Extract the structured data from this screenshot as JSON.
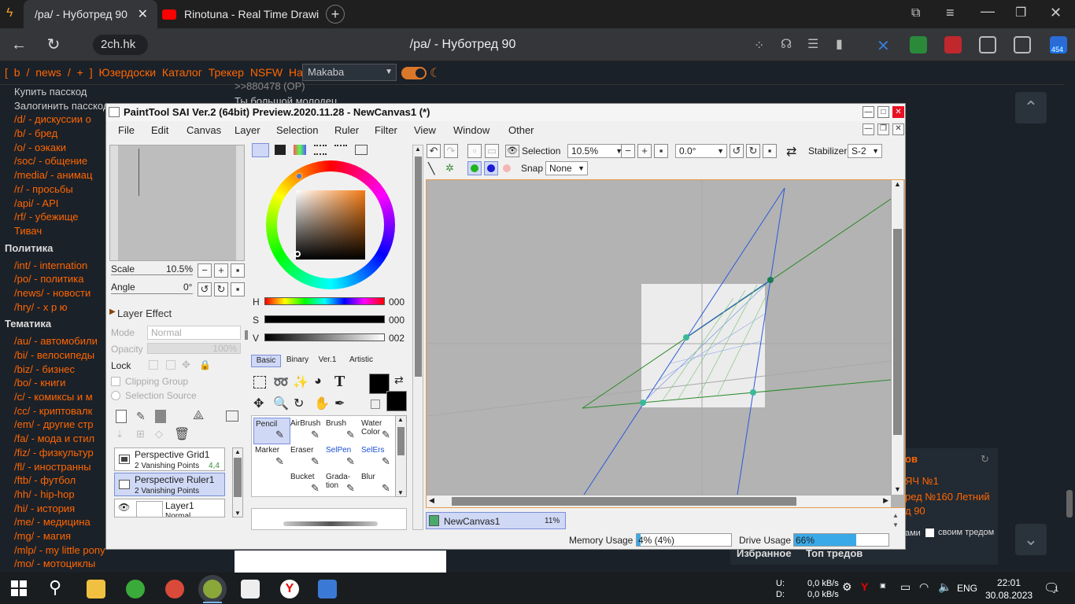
{
  "browser": {
    "tabs": [
      {
        "title": "/pa/ - Нуботред 90",
        "active": true
      },
      {
        "title": "Rinotuna - Real Time Drawi",
        "active": false
      }
    ],
    "url": "2ch.hk",
    "page_title": "/pa/ - Нуботред 90",
    "ext_badge": "454"
  },
  "site": {
    "nav_items": [
      "[",
      "b",
      "/",
      "news",
      "/",
      "+",
      "]",
      "Юзердоски",
      "Каталог",
      "Трекер",
      "NSFW",
      "Настройки"
    ],
    "style_select": "Makaba",
    "sidebar": [
      {
        "type": "item",
        "text": "Купить пасскод"
      },
      {
        "type": "item",
        "text": "Залогинить пасскод"
      },
      {
        "type": "item",
        "text": "/d/ - дискуссии о"
      },
      {
        "type": "item",
        "text": "/b/ - бред"
      },
      {
        "type": "item",
        "text": "/o/ - оэкаки"
      },
      {
        "type": "item",
        "text": "/soc/ - общение"
      },
      {
        "type": "item",
        "text": "/media/ - анимац"
      },
      {
        "type": "item",
        "text": "/r/ - просьбы"
      },
      {
        "type": "item",
        "text": "/api/ - API"
      },
      {
        "type": "item",
        "text": "/rf/ - убежище"
      },
      {
        "type": "item",
        "text": "Тивач"
      },
      {
        "type": "head",
        "text": "Политика"
      },
      {
        "type": "item",
        "text": "/int/ - internation"
      },
      {
        "type": "item",
        "text": "/po/ - политика"
      },
      {
        "type": "item",
        "text": "/news/ - новости"
      },
      {
        "type": "item",
        "text": "/hry/ - х р ю"
      },
      {
        "type": "head",
        "text": "Тематика"
      },
      {
        "type": "item",
        "text": "/au/ - автомобили"
      },
      {
        "type": "item",
        "text": "/bi/ - велосипеды"
      },
      {
        "type": "item",
        "text": "/biz/ - бизнес"
      },
      {
        "type": "item",
        "text": "/bo/ - книги"
      },
      {
        "type": "item",
        "text": "/c/ - комиксы и м"
      },
      {
        "type": "item",
        "text": "/cc/ - криптовалк"
      },
      {
        "type": "item",
        "text": "/em/ - другие стр"
      },
      {
        "type": "item",
        "text": "/fa/ - мода и стил"
      },
      {
        "type": "item",
        "text": "/fiz/ - физкультур"
      },
      {
        "type": "item",
        "text": "/fl/ - иностранны"
      },
      {
        "type": "item",
        "text": "/ftb/ - футбол"
      },
      {
        "type": "item",
        "text": "/hh/ - hip-hop"
      },
      {
        "type": "item",
        "text": "/hi/ - история"
      },
      {
        "type": "item",
        "text": "/me/ - медицина"
      },
      {
        "type": "item",
        "text": "/mg/ - магия"
      },
      {
        "type": "item",
        "text": "/mlp/ - my little pony"
      },
      {
        "type": "item",
        "text": "/mo/ - мотоциклы"
      }
    ],
    "thread_text": [
      ">>880478 (OP)",
      "Ты большой молодец"
    ],
    "right_panel": {
      "header": "ов",
      "items": [
        "ЯЧ №1",
        "ред №160 Летний",
        "д 90"
      ],
      "checkbox_prefix": "ами",
      "checkbox_label": "своим тредом",
      "tabs": [
        "Избранное",
        "Топ тредов"
      ]
    }
  },
  "sai": {
    "title": "PaintTool SAI Ver.2 (64bit) Preview.2020.11.28 - NewCanvas1 (*)",
    "menu": [
      "File",
      "Edit",
      "Canvas",
      "Layer",
      "Selection",
      "Ruler",
      "Filter",
      "View",
      "Window",
      "Other"
    ],
    "navigator": {
      "scale_label": "Scale",
      "scale_value": "10.5%",
      "angle_label": "Angle",
      "angle_value": "0°"
    },
    "layer_effect": "Layer Effect",
    "mode_label": "Mode",
    "mode_value": "Normal",
    "opacity_label": "Opacity",
    "opacity_value": "100%",
    "lock_label": "Lock",
    "clipping_group": "Clipping Group",
    "selection_source": "Selection Source",
    "layers": [
      {
        "name": "Perspective Grid1",
        "sub": "2 Vanishing Points",
        "extra": "4,4",
        "selected": false
      },
      {
        "name": "Perspective Ruler1",
        "sub": "2 Vanishing Points",
        "extra": "",
        "selected": true
      },
      {
        "name": "Layer1",
        "sub": "Normal",
        "extra": "",
        "selected": false
      }
    ],
    "hsv": [
      {
        "label": "H",
        "value": "000"
      },
      {
        "label": "S",
        "value": "000"
      },
      {
        "label": "V",
        "value": "002"
      }
    ],
    "brush_tabs": [
      "Basic",
      "Binary",
      "Ver.1",
      "Artistic"
    ],
    "tools": [
      {
        "label": "Pencil",
        "selected": true,
        "color": "#222"
      },
      {
        "label": "AirBrush",
        "selected": false,
        "color": "#222"
      },
      {
        "label": "Brush",
        "selected": false,
        "color": "#222"
      },
      {
        "label": "Water Color",
        "selected": false,
        "color": "#222"
      },
      {
        "label": "Marker",
        "selected": false,
        "color": "#222"
      },
      {
        "label": "Eraser",
        "selected": false,
        "color": "#222"
      },
      {
        "label": "SelPen",
        "selected": false,
        "color": "#1a4fd6"
      },
      {
        "label": "SelErs",
        "selected": false,
        "color": "#1a4fd6"
      },
      {
        "label": "",
        "selected": false,
        "color": "#222"
      },
      {
        "label": "Bucket",
        "selected": false,
        "color": "#222"
      },
      {
        "label": "Grada-tion",
        "selected": false,
        "color": "#222"
      },
      {
        "label": "Blur",
        "selected": false,
        "color": "#222"
      }
    ],
    "toolbar": {
      "selection_label": "Selection",
      "zoom_value": "10.5%",
      "rotation_value": "0.0°",
      "stabilizer_label": "Stabilizer",
      "stabilizer_value": "S-2",
      "snap_label": "Snap",
      "snap_value": "None"
    },
    "canvas_tab": {
      "name": "NewCanvas1",
      "zoom": "11%"
    },
    "memory_label": "Memory Usage",
    "memory_value": "4% (4%)",
    "memory_fill": 0.04,
    "drive_label": "Drive Usage",
    "drive_value": "66%",
    "drive_fill": 0.66
  },
  "taskbar": {
    "net_up_label": "U:",
    "net_down_label": "D:",
    "net_up": "0,0 kB/s",
    "net_down": "0,0 kB/s",
    "lang": "ENG",
    "time": "22:01",
    "date": "30.08.2023",
    "notif_count": "1"
  },
  "colors": {
    "accent_orange": "#ff6600",
    "sai_ruler_blue": "#2a5bd7",
    "sai_ruler_green": "#2a8a2a",
    "sai_node": "#3ab89a"
  }
}
